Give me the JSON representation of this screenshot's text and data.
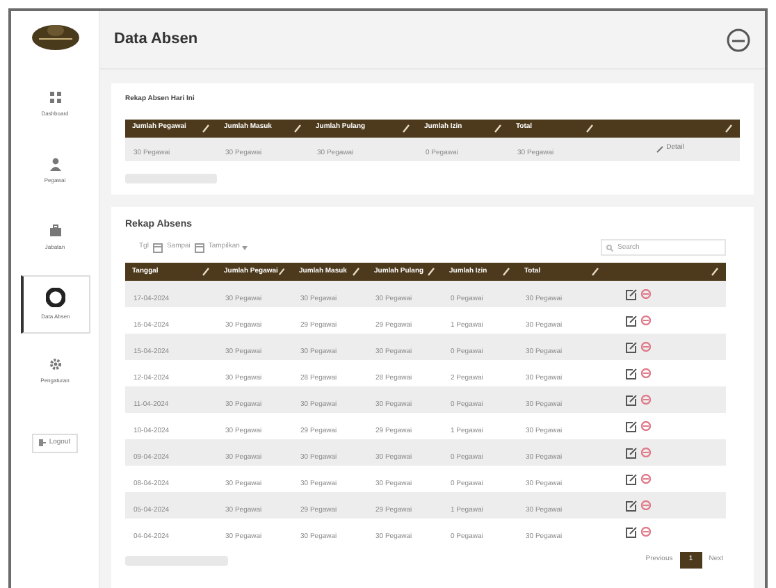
{
  "page": {
    "title": "Data Absen"
  },
  "sidebar": {
    "items": [
      {
        "label": "Dashboard",
        "kind": "grid",
        "selected": false
      },
      {
        "label": "Pegawai",
        "kind": "person",
        "selected": false
      },
      {
        "label": "Jabatan",
        "kind": "briefcase",
        "selected": false
      },
      {
        "label": "Data Absen",
        "kind": "record",
        "selected": true
      },
      {
        "label": "Pengaturan",
        "kind": "gear",
        "selected": false
      }
    ],
    "logout": "Logout"
  },
  "summary": {
    "title": "Rekap Absen Hari Ini",
    "columns": [
      "Jumlah Pegawai",
      "Jumlah Masuk",
      "Jumlah Pulang",
      "Jumlah Izin",
      "Total",
      ""
    ],
    "row": [
      "30 Pegawai",
      "30 Pegawai",
      "30 Pegawai",
      "0 Pegawai",
      "30 Pegawai"
    ],
    "action": "Detail"
  },
  "recap": {
    "title": "Rekap Absens",
    "filter": {
      "from_label": "Tgl",
      "to_label": "Sampai",
      "show": "Tampilkan"
    },
    "search": {
      "placeholder": "Search"
    },
    "columns": [
      "Tanggal",
      "Jumlah Pegawai",
      "Jumlah Masuk",
      "Jumlah Pulang",
      "Jumlah Izin",
      "Total",
      ""
    ],
    "rows": [
      [
        "17-04-2024",
        "30 Pegawai",
        "30 Pegawai",
        "30 Pegawai",
        "0 Pegawai",
        "30 Pegawai"
      ],
      [
        "16-04-2024",
        "30 Pegawai",
        "29 Pegawai",
        "29 Pegawai",
        "1 Pegawai",
        "30 Pegawai"
      ],
      [
        "15-04-2024",
        "30 Pegawai",
        "30 Pegawai",
        "30 Pegawai",
        "0 Pegawai",
        "30 Pegawai"
      ],
      [
        "12-04-2024",
        "30 Pegawai",
        "28 Pegawai",
        "28 Pegawai",
        "2 Pegawai",
        "30 Pegawai"
      ],
      [
        "11-04-2024",
        "30 Pegawai",
        "30 Pegawai",
        "30 Pegawai",
        "0 Pegawai",
        "30 Pegawai"
      ],
      [
        "10-04-2024",
        "30 Pegawai",
        "29 Pegawai",
        "29 Pegawai",
        "1 Pegawai",
        "30 Pegawai"
      ],
      [
        "09-04-2024",
        "30 Pegawai",
        "30 Pegawai",
        "30 Pegawai",
        "0 Pegawai",
        "30 Pegawai"
      ],
      [
        "08-04-2024",
        "30 Pegawai",
        "30 Pegawai",
        "30 Pegawai",
        "0 Pegawai",
        "30 Pegawai"
      ],
      [
        "05-04-2024",
        "30 Pegawai",
        "29 Pegawai",
        "29 Pegawai",
        "1 Pegawai",
        "30 Pegawai"
      ],
      [
        "04-04-2024",
        "30 Pegawai",
        "30 Pegawai",
        "30 Pegawai",
        "0 Pegawai",
        "30 Pegawai"
      ]
    ],
    "pagination": [
      {
        "label": "Previous",
        "selected": false
      },
      {
        "label": "1",
        "selected": true
      },
      {
        "label": "Next",
        "selected": false
      }
    ]
  }
}
